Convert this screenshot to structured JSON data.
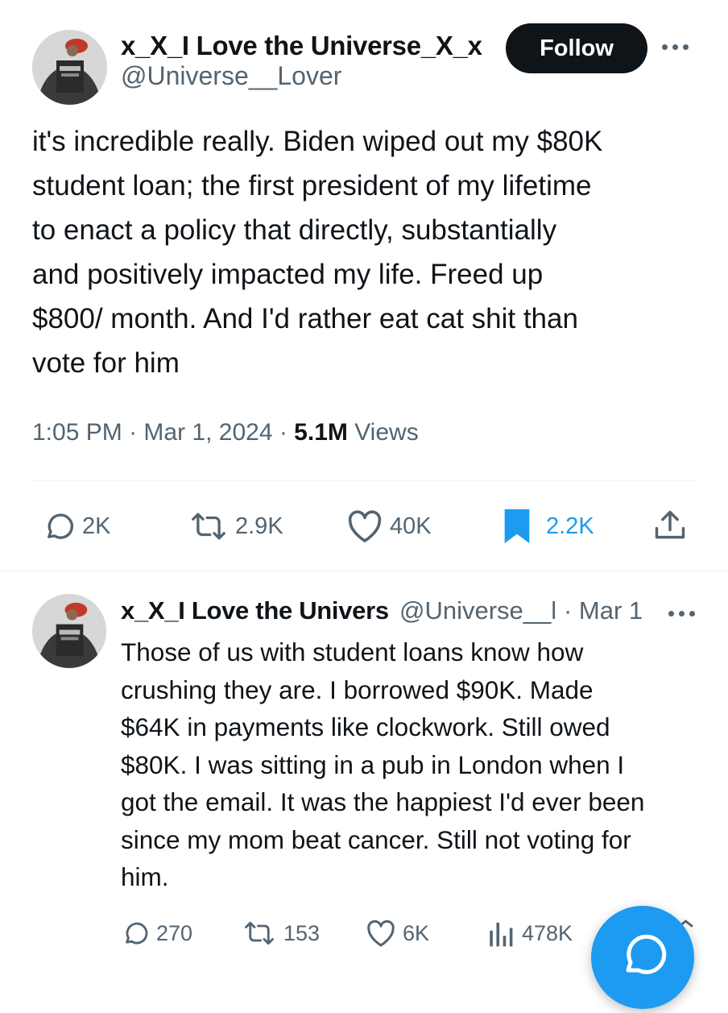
{
  "main_tweet": {
    "display_name": "x_X_I Love the Universe_X_x",
    "handle": "@Universe__Lover",
    "follow_label": "Follow",
    "text": "it's incredible really. Biden wiped out my $80K\nstudent loan; the first president of my lifetime\nto enact a policy that directly, substantially\nand positively impacted my life. Freed up\n$800/ month. And I'd rather eat cat shit than\nvote for him",
    "time": "1:05 PM",
    "date": "Mar 1, 2024",
    "views_count": "5.1M",
    "views_label": "Views",
    "actions": {
      "replies": "2K",
      "reposts": "2.9K",
      "likes": "40K",
      "bookmarks": "2.2K"
    },
    "colors": {
      "bookmark_active": "#1d9bf0"
    }
  },
  "reply_tweet": {
    "display_name": "x_X_I Love the Univers",
    "handle": "@Universe__l",
    "date": "· Mar 1",
    "text": "Those of us with student loans know how\ncrushing they are. I borrowed $90K. Made\n$64K in payments like clockwork. Still owed\n$80K. I was sitting in a pub in London when I\ngot the email. It was the happiest I'd ever been\nsince my mom beat cancer. Still not voting for\nhim.",
    "actions": {
      "replies": "270",
      "reposts": "153",
      "likes": "6K",
      "views": "478K"
    }
  },
  "fab": {
    "icon": "compose-reply-icon",
    "color": "#1d9bf0"
  }
}
